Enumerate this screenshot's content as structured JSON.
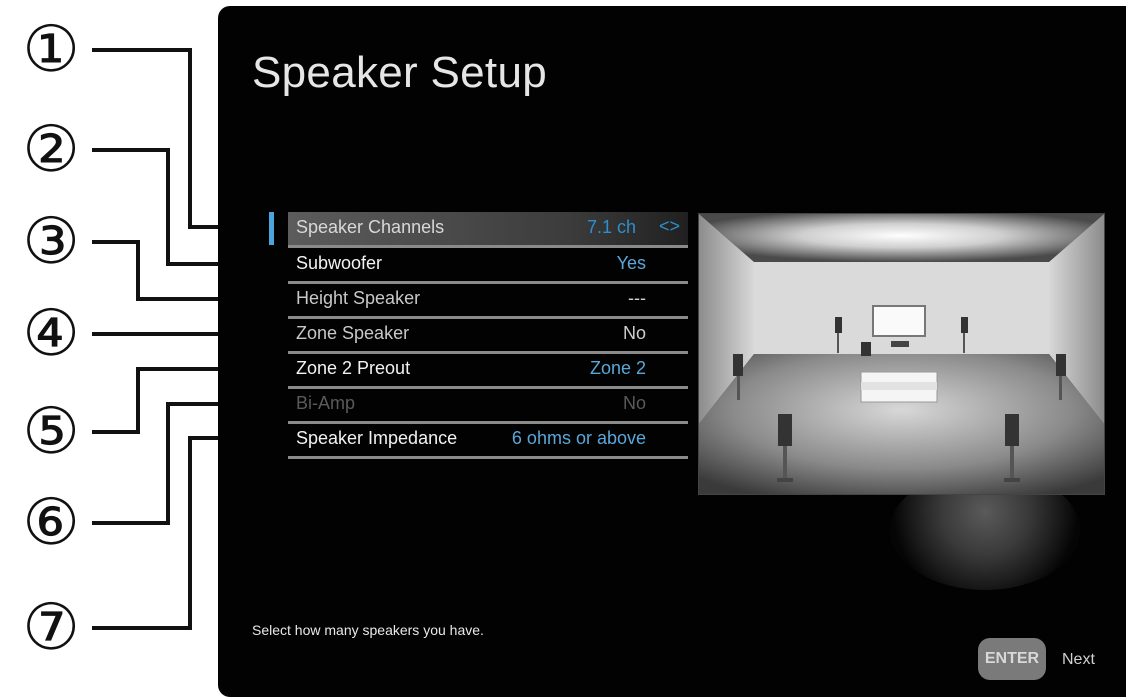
{
  "screen": {
    "title": "Speaker Setup",
    "hint": "Select how many speakers you have.",
    "enter_label": "ENTER",
    "next_label": "Next"
  },
  "callouts": [
    "①",
    "②",
    "③",
    "④",
    "⑤",
    "⑥",
    "⑦"
  ],
  "settings": [
    {
      "label": "Speaker Channels",
      "value": "7.1 ch",
      "arrows": "<>"
    },
    {
      "label": "Subwoofer",
      "value": "Yes"
    },
    {
      "label": "Height Speaker",
      "value": "---"
    },
    {
      "label": "Zone Speaker",
      "value": "No"
    },
    {
      "label": "Zone 2 Preout",
      "value": "Zone 2"
    },
    {
      "label": "Bi-Amp",
      "value": "No"
    },
    {
      "label": "Speaker Impedance",
      "value": "6 ohms or above"
    }
  ],
  "colors": {
    "accent": "#4ba4dc",
    "value_blue": "#5aa7d9",
    "background": "#020202"
  }
}
